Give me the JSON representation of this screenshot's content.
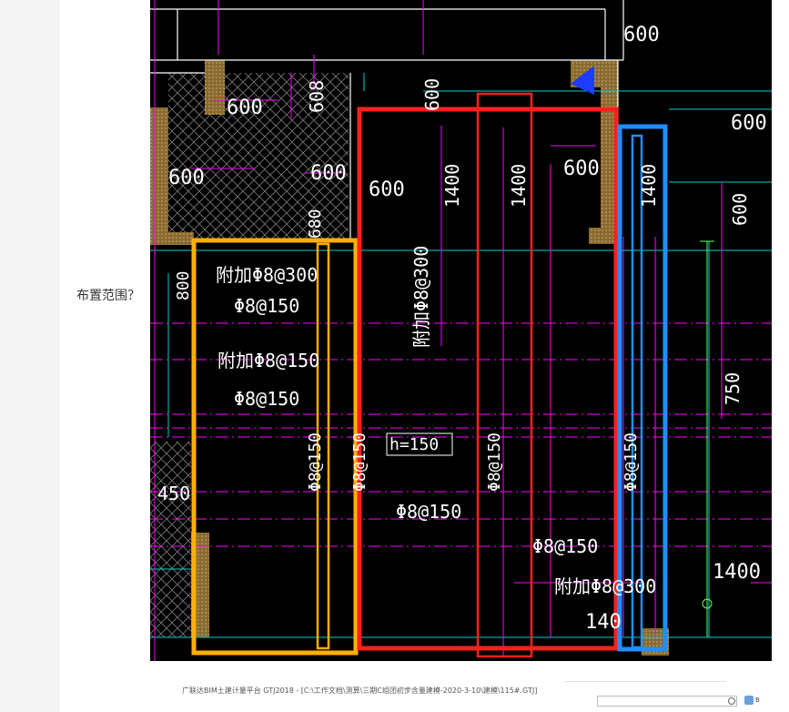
{
  "question": {
    "text": "布置范围？"
  },
  "footer": {
    "caption": "广联达BIM土建计量平台 GTJ2018 - [C:\\工作文档\\测算\\三期C组团初步含量建模-2020-3-10\\建模\\115#.GTJ]",
    "search_placeholder": "",
    "user_label": "B"
  },
  "drawing": {
    "dims": {
      "d600_top": "600",
      "d600_a": "600",
      "d608": "608",
      "d600_b": "600",
      "d600_c": "600",
      "d600_d": "600",
      "d600_e": "600",
      "d600_f": "600",
      "d600_right": "600",
      "d600_right2": "600",
      "d1400_a": "1400",
      "d1400_b": "1400",
      "d1400_c": "1400",
      "d1400_d": "1400",
      "d140": "140",
      "d600_v": "600",
      "d800": "800",
      "d750": "750",
      "d450": "450",
      "d680": "680"
    },
    "rebar": {
      "r1": "附加Φ8@300",
      "r2": "Φ8@150",
      "r3": "附加Φ8@150",
      "r4": "Φ8@150",
      "r5": "附加Φ8@300",
      "r6": "Φ8@150",
      "r7": "Φ8@150",
      "r8": "Φ8@150",
      "r9": "Φ8@150",
      "r10": "Φ8@150",
      "r11": "附加Φ8@300",
      "r12": "Φ8@150"
    },
    "slab_height": "h=150"
  },
  "colors": {
    "yellow": "#ffb000",
    "red": "#ff2020",
    "blue": "#1e90ff",
    "magenta": "#ff00ff",
    "cyan": "#00d0d0",
    "hatch": "#a08040"
  }
}
